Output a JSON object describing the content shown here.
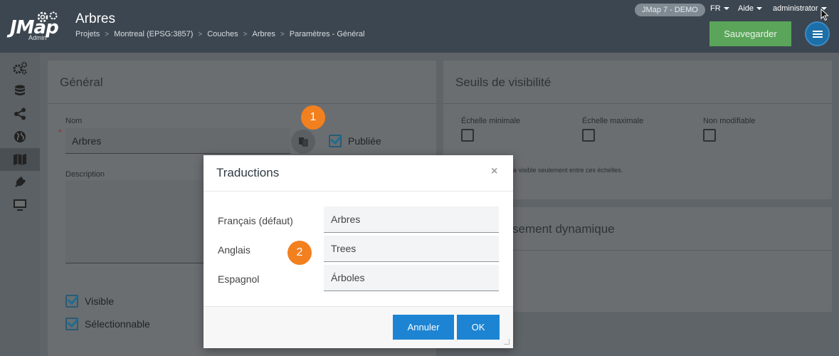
{
  "header": {
    "logo_text": "JMap",
    "logo_sub": "Admin",
    "title": "Arbres",
    "breadcrumb": [
      "Projets",
      "Montreal (EPSG:3857)",
      "Couches",
      "Arbres",
      "Paramètres - Général"
    ],
    "env_badge": "JMap 7 - DEMO",
    "language": "FR",
    "help": "Aide",
    "user": "administrator",
    "save_label": "Sauvegarder"
  },
  "sidebar": {
    "icons": [
      "gears-icon",
      "database-icon",
      "share-icon",
      "globe-icon",
      "map-icon",
      "plug-icon",
      "monitor-icon"
    ]
  },
  "general_panel": {
    "title": "Général",
    "name_label": "Nom",
    "name_value": "Arbres",
    "published_label": "Publiée",
    "description_label": "Description",
    "visible_label": "Visible",
    "selectable_label": "Sélectionnable"
  },
  "visibility_panel": {
    "title": "Seuils de visibilité",
    "min_scale_label": "Échelle minimale",
    "max_scale_label": "Échelle maximale",
    "non_editable_label": "Non modifiable",
    "hint": "a visible seulement entre ces échelles."
  },
  "dynamic_panel": {
    "title": "sement dynamique"
  },
  "modal": {
    "title": "Traductions",
    "close": "×",
    "rows": [
      {
        "label": "Français (défaut)",
        "value": "Arbres"
      },
      {
        "label": "Anglais",
        "value": "Trees"
      },
      {
        "label": "Espagnol",
        "value": "Árboles"
      }
    ],
    "cancel_label": "Annuler",
    "ok_label": "OK"
  },
  "markers": [
    "1",
    "2"
  ],
  "colors": {
    "header_bg": "#3c4650",
    "save_green": "#5aa55a",
    "primary_blue": "#1c84d2",
    "marker_orange": "#f2801f"
  }
}
